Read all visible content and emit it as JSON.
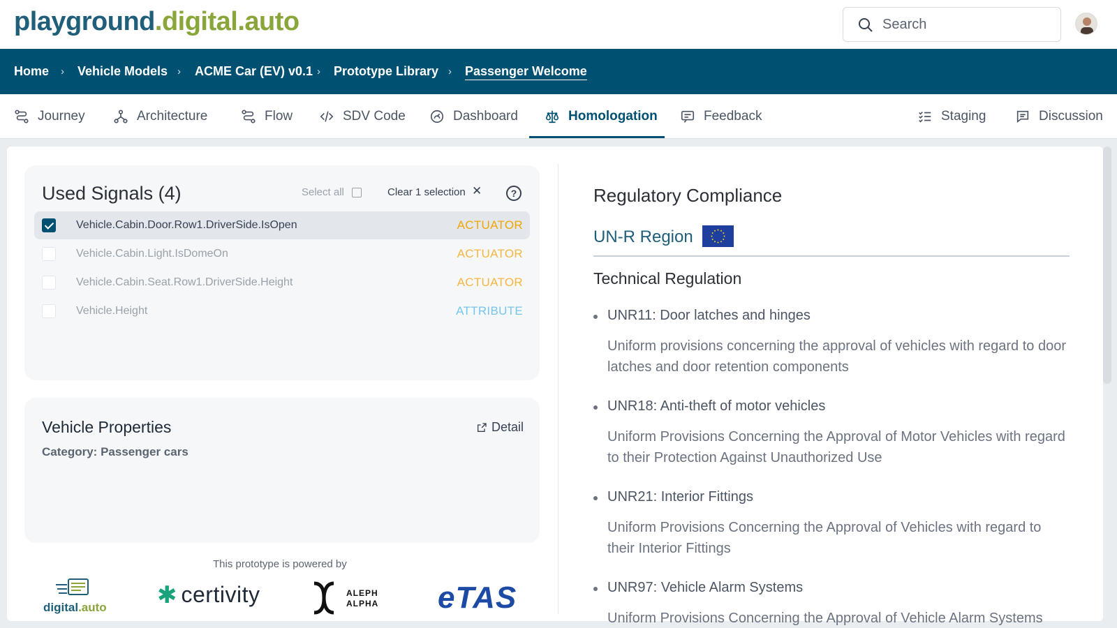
{
  "header": {
    "logo_part1": "playground",
    "logo_dot": ".",
    "logo_part2": "digital",
    "logo_part3": ".auto",
    "search_placeholder": "Search"
  },
  "breadcrumb": [
    {
      "label": "Home"
    },
    {
      "label": "Vehicle Models"
    },
    {
      "label": "ACME Car (EV) v0.1"
    },
    {
      "label": "Prototype Library"
    },
    {
      "label": "Passenger Welcome"
    }
  ],
  "tabs": [
    {
      "label": "Journey",
      "icon": "journey-icon"
    },
    {
      "label": "Architecture",
      "icon": "architecture-icon"
    },
    {
      "label": "Flow",
      "icon": "flow-icon"
    },
    {
      "label": "SDV Code",
      "icon": "code-icon"
    },
    {
      "label": "Dashboard",
      "icon": "dashboard-icon"
    },
    {
      "label": "Homologation",
      "icon": "scale-icon",
      "active": true
    },
    {
      "label": "Feedback",
      "icon": "feedback-icon"
    },
    {
      "label": "Staging",
      "icon": "staging-icon"
    },
    {
      "label": "Discussion",
      "icon": "discussion-icon"
    }
  ],
  "used_signals": {
    "title": "Used Signals (4)",
    "select_all_label": "Select all",
    "clear_label": "Clear 1 selection",
    "help_label": "?",
    "signals": [
      {
        "name": "Vehicle.Cabin.Door.Row1.DriverSide.IsOpen",
        "type": "ACTUATOR",
        "checked": true
      },
      {
        "name": "Vehicle.Cabin.Light.IsDomeOn",
        "type": "ACTUATOR",
        "checked": false
      },
      {
        "name": "Vehicle.Cabin.Seat.Row1.DriverSide.Height",
        "type": "ACTUATOR",
        "checked": false
      },
      {
        "name": "Vehicle.Height",
        "type": "ATTRIBUTE",
        "checked": false
      }
    ]
  },
  "vehicle_properties": {
    "title": "Vehicle Properties",
    "category": "Category: Passenger cars",
    "detail_label": "Detail"
  },
  "powered_by": {
    "label": "This prototype is powered by",
    "partners": {
      "digital_auto_a": "digital",
      "digital_auto_b": ".auto",
      "certivity": "certivity",
      "aleph_1": "ALEPH",
      "aleph_2": "ALPHA",
      "etas": "eTAS"
    }
  },
  "compliance": {
    "title": "Regulatory Compliance",
    "region_label": "UN-R Region",
    "technical_title": "Technical Regulation",
    "regulations": [
      {
        "name": "UNR11: Door latches and hinges",
        "description": "Uniform provisions concerning the approval of vehicles with regard to door latches and door retention components"
      },
      {
        "name": "UNR18: Anti-theft of motor vehicles",
        "description": "Uniform Provisions Concerning the Approval of Motor Vehicles with regard to their Protection Against Unauthorized Use"
      },
      {
        "name": "UNR21: Interior Fittings",
        "description": "Uniform Provisions Concerning the Approval of Vehicles with regard to their Interior Fittings"
      },
      {
        "name": "UNR97: Vehicle Alarm Systems",
        "description": "Uniform Provisions Concerning the Approval of Vehicle Alarm Systems"
      }
    ]
  },
  "colors": {
    "brand_blue": "#005072",
    "brand_green": "#8aa63a",
    "actuator": "#f0a500",
    "attribute": "#75c6ea",
    "eu_blue": "#1e3f9e"
  }
}
